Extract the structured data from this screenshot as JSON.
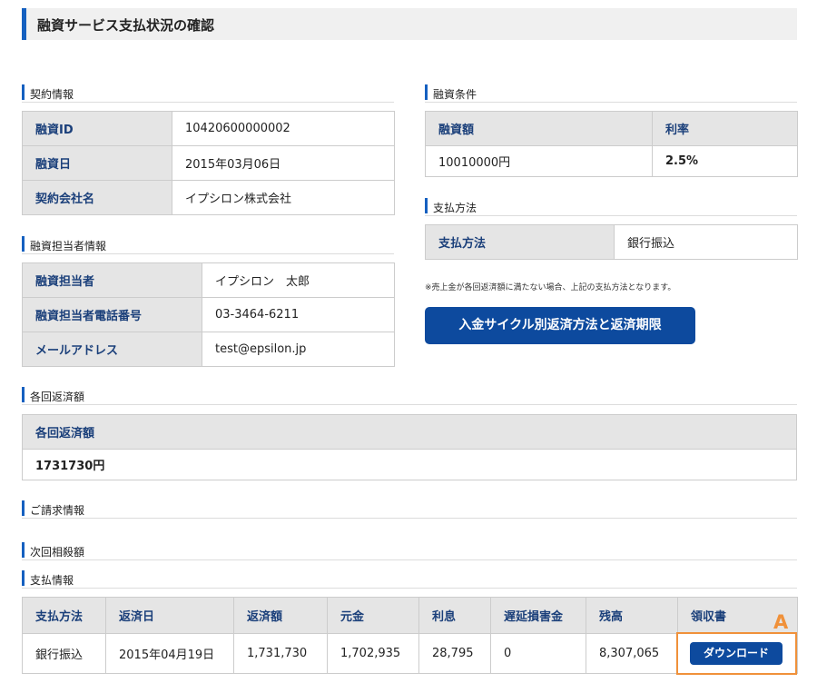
{
  "page_title": "融資サービス支払状況の確認",
  "contract": {
    "heading": "契約情報",
    "rows": [
      {
        "label": "融資ID",
        "value": "10420600000002"
      },
      {
        "label": "融資日",
        "value": "2015年03月06日"
      },
      {
        "label": "契約会社名",
        "value": "イプシロン株式会社"
      }
    ]
  },
  "officer": {
    "heading": "融資担当者情報",
    "rows": [
      {
        "label": "融資担当者",
        "value": "イプシロン　太郎"
      },
      {
        "label": "融資担当者電話番号",
        "value": "03-3464-6211"
      },
      {
        "label": "メールアドレス",
        "value": "test@epsilon.jp"
      }
    ]
  },
  "conditions": {
    "heading": "融資条件",
    "headers": [
      "融資額",
      "利率"
    ],
    "values": [
      "10010000円",
      "2.5%"
    ]
  },
  "payment_method": {
    "heading": "支払方法",
    "label": "支払方法",
    "value": "銀行振込",
    "note": "※売上金が各回返済額に満たない場合、上記の支払方法となります。",
    "button_label": "入金サイクル別返済方法と返済期限"
  },
  "installment": {
    "heading": "各回返済額",
    "header": "各回返済額",
    "value": "1731730円"
  },
  "billing_heading": "ご請求情報",
  "next_offset_heading": "次回相殺額",
  "payment_info": {
    "heading": "支払情報",
    "columns": [
      "支払方法",
      "返済日",
      "返済額",
      "元金",
      "利息",
      "遅延損害金",
      "残高",
      "領収書"
    ],
    "row": [
      "銀行振込",
      "2015年04月19日",
      "1,731,730",
      "1,702,935",
      "28,795",
      "0",
      "8,307,065"
    ],
    "download_label": "ダウンロード"
  },
  "annotation_marker": "A",
  "colors": {
    "accent": "#1560c0",
    "button": "#0d4a9e",
    "highlight": "#f0913a"
  }
}
